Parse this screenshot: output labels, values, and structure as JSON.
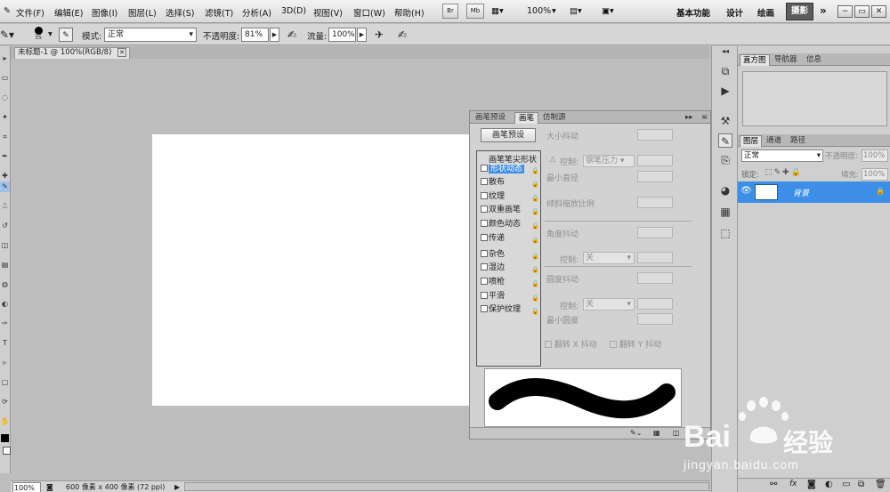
{
  "menubar": {
    "items": [
      "文件(F)",
      "编辑(E)",
      "图像(I)",
      "图层(L)",
      "选择(S)",
      "滤镜(T)",
      "分析(A)",
      "3D(D)",
      "视图(V)",
      "窗口(W)",
      "帮助(H)"
    ],
    "btn_br": "Br",
    "btn_mb": "Mb",
    "zoom": "100%",
    "workspaces": [
      "基本功能",
      "设计",
      "绘画"
    ],
    "active_workspace": "摄影",
    "more": "»",
    "win_min": "−",
    "win_restore": "▭",
    "win_close": "✕"
  },
  "options": {
    "brush_size": "35",
    "mode_label": "模式:",
    "mode_value": "正常",
    "opacity_label": "不透明度:",
    "opacity_value": "81%",
    "flow_label": "流量:",
    "flow_value": "100%"
  },
  "document": {
    "tab_title": "未标题-1 @ 100%(RGB/8)",
    "tab_close": "✕"
  },
  "status": {
    "zoom": "100%",
    "info": "600 像素 x 400 像素 (72 ppi)"
  },
  "brush_panel": {
    "tabs": [
      "画笔预设",
      "画笔",
      "仿制源"
    ],
    "active_tab": 1,
    "preset_button": "画笔预设",
    "list_header": "画笔笔尖形状",
    "options": [
      "形状动态",
      "散布",
      "纹理",
      "双重画笔",
      "颜色动态",
      "传递",
      "杂色",
      "湿边",
      "喷枪",
      "平滑",
      "保护纹理"
    ],
    "selected_option": "形状动态",
    "controls": {
      "size_jitter": "大小抖动",
      "control_label": "控制:",
      "control_pen": "钢笔压力",
      "min_diameter": "最小直径",
      "tilt_scale": "倾斜缩放比例",
      "angle_jitter": "角度抖动",
      "control_off": "关",
      "roundness_jitter": "圆度抖动",
      "min_roundness": "最小圆度",
      "flip_x": "翻转 X 抖动",
      "flip_y": "翻转 Y 抖动"
    }
  },
  "right_panels": {
    "top_tabs": [
      "直方图",
      "导航器",
      "信息"
    ],
    "layer_tabs": [
      "图层",
      "通道",
      "路径"
    ],
    "blend_mode": "正常",
    "opacity_label": "不透明度:",
    "opacity_value": "100%",
    "lock_label": "锁定:",
    "fill_label": "填充:",
    "fill_value": "100%",
    "layer_name": "背景",
    "bottom_icons": [
      "link-icon",
      "fx-icon",
      "mask-icon",
      "adjustment-icon",
      "folder-icon",
      "new-layer-icon",
      "trash-icon"
    ]
  },
  "watermark": {
    "brand": "Bai",
    "brand_tail": "经验",
    "url": "jingyan.baidu.com"
  }
}
